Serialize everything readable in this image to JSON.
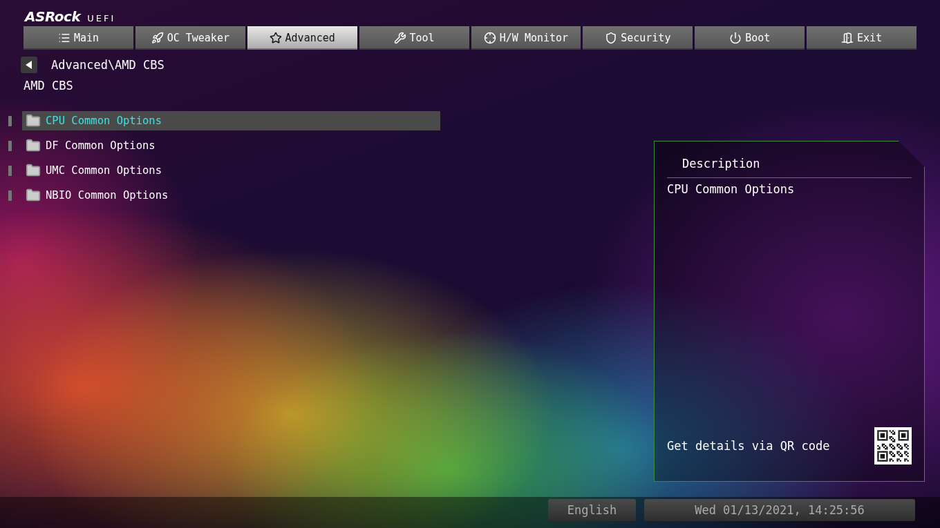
{
  "logo": {
    "brand": "ASRock",
    "product": "UEFI"
  },
  "tabs": [
    {
      "label": "Main",
      "selected": false
    },
    {
      "label": "OC Tweaker",
      "selected": false
    },
    {
      "label": "Advanced",
      "selected": true
    },
    {
      "label": "Tool",
      "selected": false
    },
    {
      "label": "H/W Monitor",
      "selected": false
    },
    {
      "label": "Security",
      "selected": false
    },
    {
      "label": "Boot",
      "selected": false
    },
    {
      "label": "Exit",
      "selected": false
    }
  ],
  "breadcrumb": "Advanced\\AMD CBS",
  "page_title": "AMD CBS",
  "menu_items": [
    {
      "label": "CPU Common Options",
      "selected": true
    },
    {
      "label": "DF Common Options",
      "selected": false
    },
    {
      "label": "UMC Common Options",
      "selected": false
    },
    {
      "label": "NBIO Common Options",
      "selected": false
    }
  ],
  "description": {
    "title": "Description",
    "text": "CPU Common Options",
    "qr_hint": "Get details via QR code"
  },
  "status_bar": {
    "language": "English",
    "datetime": "Wed 01/13/2021, 14:25:56"
  }
}
